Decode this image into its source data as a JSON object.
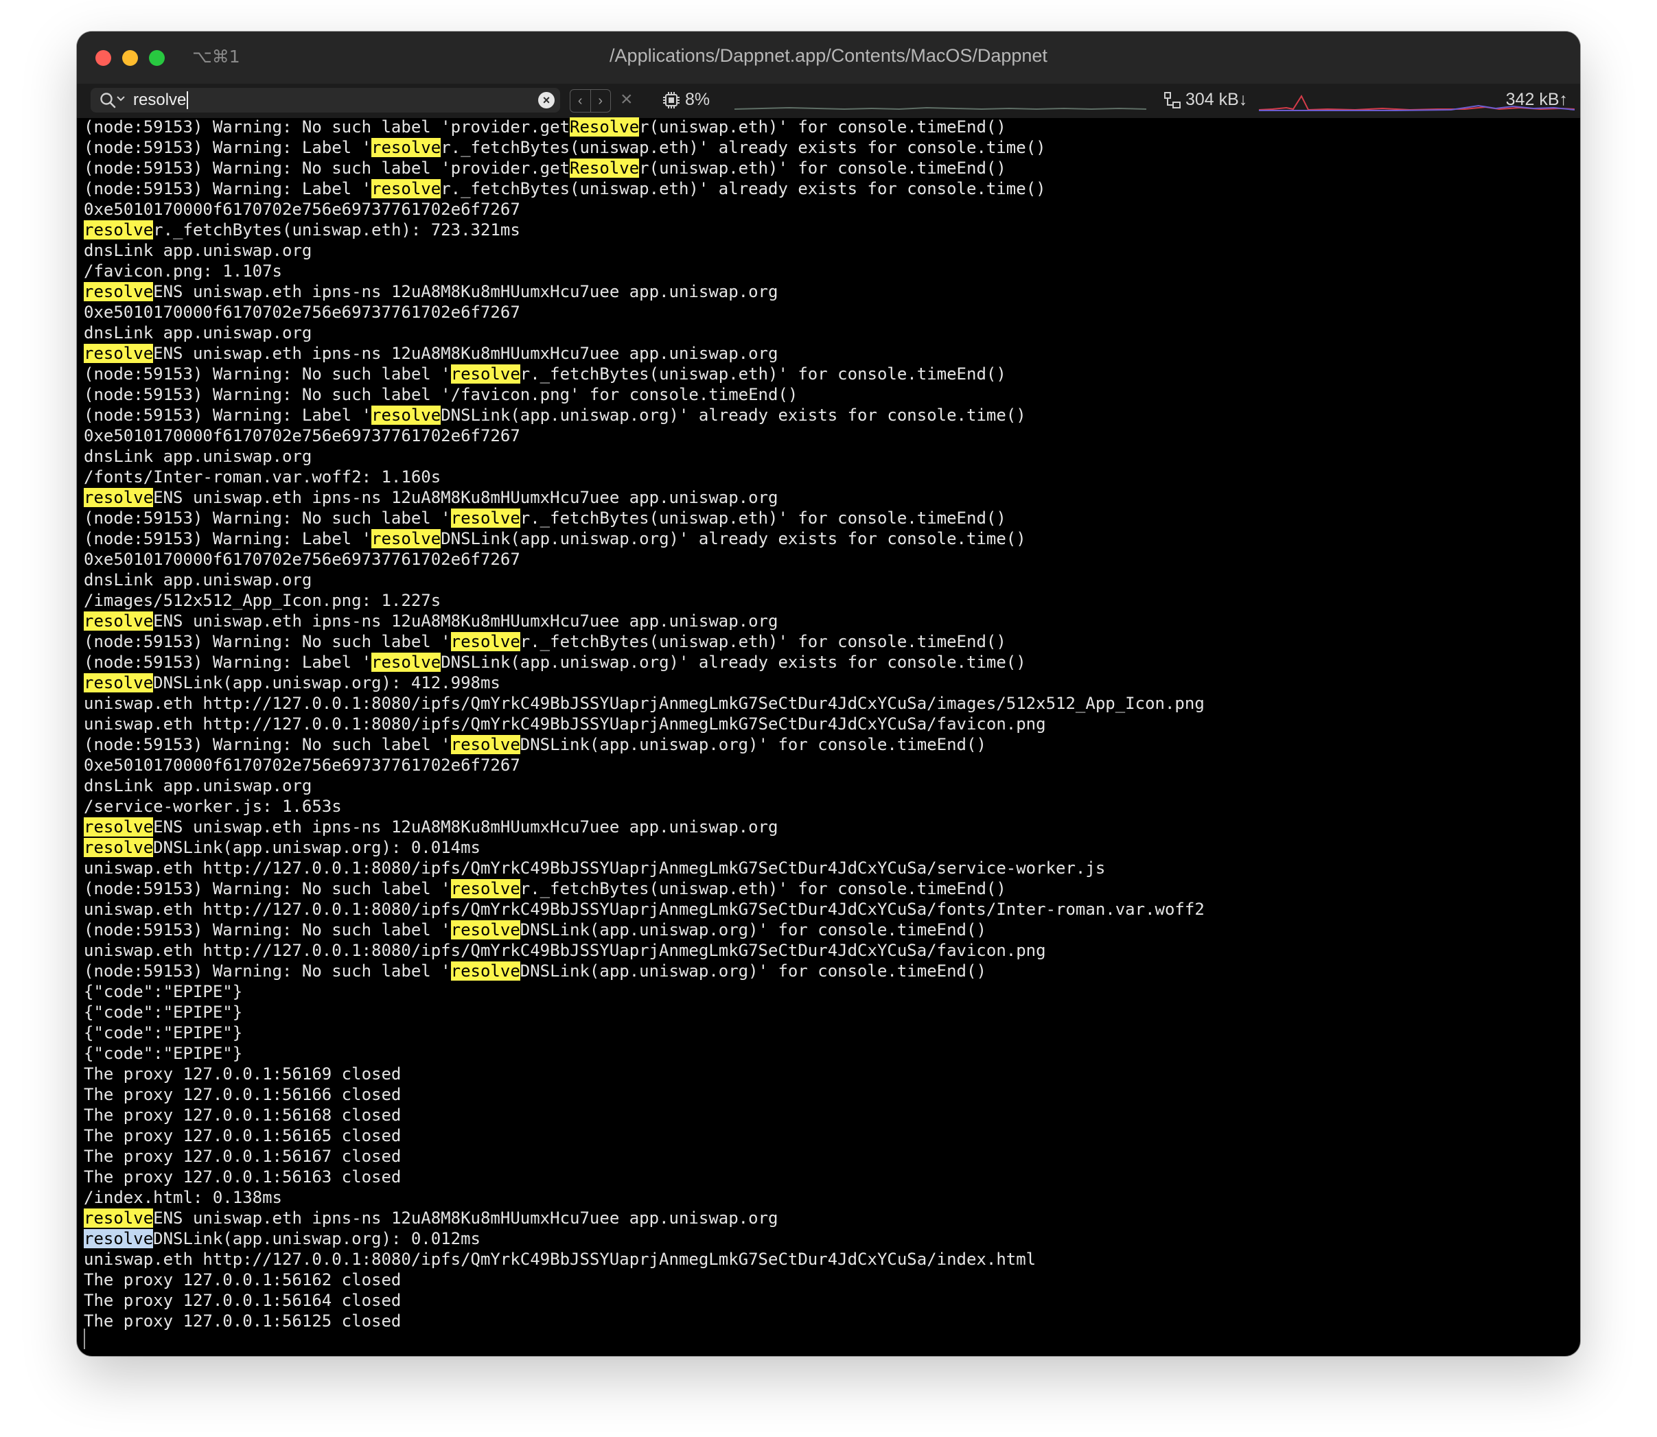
{
  "window": {
    "title": "/Applications/Dappnet.app/Contents/MacOS/Dappnet",
    "shortcut": "⌥⌘1"
  },
  "search": {
    "query": "resolve",
    "prev_icon": "chevron-left-icon",
    "next_icon": "chevron-right-icon"
  },
  "status": {
    "cpu": "8%",
    "net_down": "304 kB↓",
    "net_up": "342 kB↑"
  },
  "colors": {
    "match_highlight": "#fcf54c",
    "active_match_highlight": "#c2d8f2",
    "net_graph_red": "#d43c4a",
    "net_graph_purple": "#6b5ccf"
  },
  "terminal": {
    "lines": [
      {
        "segments": [
          {
            "t": "(node:59153) Warning: No such label 'provider.get"
          },
          {
            "t": "Resolve",
            "hl": true
          },
          {
            "t": "r(uniswap.eth)' for console.timeEnd()"
          }
        ]
      },
      {
        "segments": [
          {
            "t": "(node:59153) Warning: Label '"
          },
          {
            "t": "resolve",
            "hl": true
          },
          {
            "t": "r._fetchBytes(uniswap.eth)' already exists for console.time()"
          }
        ]
      },
      {
        "segments": [
          {
            "t": "(node:59153) Warning: No such label 'provider.get"
          },
          {
            "t": "Resolve",
            "hl": true
          },
          {
            "t": "r(uniswap.eth)' for console.timeEnd()"
          }
        ]
      },
      {
        "segments": [
          {
            "t": "(node:59153) Warning: Label '"
          },
          {
            "t": "resolve",
            "hl": true
          },
          {
            "t": "r._fetchBytes(uniswap.eth)' already exists for console.time()"
          }
        ]
      },
      {
        "segments": [
          {
            "t": "0xe5010170000f6170702e756e69737761702e6f7267"
          }
        ]
      },
      {
        "segments": [
          {
            "t": "resolve",
            "hl": true
          },
          {
            "t": "r._fetchBytes(uniswap.eth): 723.321ms"
          }
        ]
      },
      {
        "segments": [
          {
            "t": "dnsLink app.uniswap.org"
          }
        ]
      },
      {
        "segments": [
          {
            "t": "/favicon.png: 1.107s"
          }
        ]
      },
      {
        "segments": [
          {
            "t": "resolve",
            "hl": true
          },
          {
            "t": "ENS uniswap.eth ipns-ns 12uA8M8Ku8mHUumxHcu7uee app.uniswap.org"
          }
        ]
      },
      {
        "segments": [
          {
            "t": "0xe5010170000f6170702e756e69737761702e6f7267"
          }
        ]
      },
      {
        "segments": [
          {
            "t": "dnsLink app.uniswap.org"
          }
        ]
      },
      {
        "segments": [
          {
            "t": "resolve",
            "hl": true
          },
          {
            "t": "ENS uniswap.eth ipns-ns 12uA8M8Ku8mHUumxHcu7uee app.uniswap.org"
          }
        ]
      },
      {
        "segments": [
          {
            "t": "(node:59153) Warning: No such label '"
          },
          {
            "t": "resolve",
            "hl": true
          },
          {
            "t": "r._fetchBytes(uniswap.eth)' for console.timeEnd()"
          }
        ]
      },
      {
        "segments": [
          {
            "t": "(node:59153) Warning: No such label '/favicon.png' for console.timeEnd()"
          }
        ]
      },
      {
        "segments": [
          {
            "t": "(node:59153) Warning: Label '"
          },
          {
            "t": "resolve",
            "hl": true
          },
          {
            "t": "DNSLink(app.uniswap.org)' already exists for console.time()"
          }
        ]
      },
      {
        "segments": [
          {
            "t": "0xe5010170000f6170702e756e69737761702e6f7267"
          }
        ]
      },
      {
        "segments": [
          {
            "t": "dnsLink app.uniswap.org"
          }
        ]
      },
      {
        "segments": [
          {
            "t": "/fonts/Inter-roman.var.woff2: 1.160s"
          }
        ]
      },
      {
        "segments": [
          {
            "t": "resolve",
            "hl": true
          },
          {
            "t": "ENS uniswap.eth ipns-ns 12uA8M8Ku8mHUumxHcu7uee app.uniswap.org"
          }
        ]
      },
      {
        "segments": [
          {
            "t": "(node:59153) Warning: No such label '"
          },
          {
            "t": "resolve",
            "hl": true
          },
          {
            "t": "r._fetchBytes(uniswap.eth)' for console.timeEnd()"
          }
        ]
      },
      {
        "segments": [
          {
            "t": "(node:59153) Warning: Label '"
          },
          {
            "t": "resolve",
            "hl": true
          },
          {
            "t": "DNSLink(app.uniswap.org)' already exists for console.time()"
          }
        ]
      },
      {
        "segments": [
          {
            "t": "0xe5010170000f6170702e756e69737761702e6f7267"
          }
        ]
      },
      {
        "segments": [
          {
            "t": "dnsLink app.uniswap.org"
          }
        ]
      },
      {
        "segments": [
          {
            "t": "/images/512x512_App_Icon.png: 1.227s"
          }
        ]
      },
      {
        "segments": [
          {
            "t": "resolve",
            "hl": true
          },
          {
            "t": "ENS uniswap.eth ipns-ns 12uA8M8Ku8mHUumxHcu7uee app.uniswap.org"
          }
        ]
      },
      {
        "segments": [
          {
            "t": "(node:59153) Warning: No such label '"
          },
          {
            "t": "resolve",
            "hl": true
          },
          {
            "t": "r._fetchBytes(uniswap.eth)' for console.timeEnd()"
          }
        ]
      },
      {
        "segments": [
          {
            "t": "(node:59153) Warning: Label '"
          },
          {
            "t": "resolve",
            "hl": true
          },
          {
            "t": "DNSLink(app.uniswap.org)' already exists for console.time()"
          }
        ]
      },
      {
        "segments": [
          {
            "t": "resolve",
            "hl": true
          },
          {
            "t": "DNSLink(app.uniswap.org): 412.998ms"
          }
        ]
      },
      {
        "segments": [
          {
            "t": "uniswap.eth http://127.0.0.1:8080/ipfs/QmYrkC49BbJSSYUaprjAnmegLmkG7SeCtDur4JdCxYCuSa/images/512x512_App_Icon.png"
          }
        ]
      },
      {
        "segments": [
          {
            "t": "uniswap.eth http://127.0.0.1:8080/ipfs/QmYrkC49BbJSSYUaprjAnmegLmkG7SeCtDur4JdCxYCuSa/favicon.png"
          }
        ]
      },
      {
        "segments": [
          {
            "t": "(node:59153) Warning: No such label '"
          },
          {
            "t": "resolve",
            "hl": true
          },
          {
            "t": "DNSLink(app.uniswap.org)' for console.timeEnd()"
          }
        ]
      },
      {
        "segments": [
          {
            "t": "0xe5010170000f6170702e756e69737761702e6f7267"
          }
        ]
      },
      {
        "segments": [
          {
            "t": "dnsLink app.uniswap.org"
          }
        ]
      },
      {
        "segments": [
          {
            "t": "/service-worker.js: 1.653s"
          }
        ]
      },
      {
        "segments": [
          {
            "t": "resolve",
            "hl": true
          },
          {
            "t": "ENS uniswap.eth ipns-ns 12uA8M8Ku8mHUumxHcu7uee app.uniswap.org"
          }
        ]
      },
      {
        "segments": [
          {
            "t": "resolve",
            "hl": true
          },
          {
            "t": "DNSLink(app.uniswap.org): 0.014ms"
          }
        ]
      },
      {
        "segments": [
          {
            "t": "uniswap.eth http://127.0.0.1:8080/ipfs/QmYrkC49BbJSSYUaprjAnmegLmkG7SeCtDur4JdCxYCuSa/service-worker.js"
          }
        ]
      },
      {
        "segments": [
          {
            "t": "(node:59153) Warning: No such label '"
          },
          {
            "t": "resolve",
            "hl": true
          },
          {
            "t": "r._fetchBytes(uniswap.eth)' for console.timeEnd()"
          }
        ]
      },
      {
        "segments": [
          {
            "t": "uniswap.eth http://127.0.0.1:8080/ipfs/QmYrkC49BbJSSYUaprjAnmegLmkG7SeCtDur4JdCxYCuSa/fonts/Inter-roman.var.woff2"
          }
        ]
      },
      {
        "segments": [
          {
            "t": "(node:59153) Warning: No such label '"
          },
          {
            "t": "resolve",
            "hl": true
          },
          {
            "t": "DNSLink(app.uniswap.org)' for console.timeEnd()"
          }
        ]
      },
      {
        "segments": [
          {
            "t": "uniswap.eth http://127.0.0.1:8080/ipfs/QmYrkC49BbJSSYUaprjAnmegLmkG7SeCtDur4JdCxYCuSa/favicon.png"
          }
        ]
      },
      {
        "segments": [
          {
            "t": "(node:59153) Warning: No such label '"
          },
          {
            "t": "resolve",
            "hl": true
          },
          {
            "t": "DNSLink(app.uniswap.org)' for console.timeEnd()"
          }
        ]
      },
      {
        "segments": [
          {
            "t": "{\"code\":\"EPIPE\"}"
          }
        ]
      },
      {
        "segments": [
          {
            "t": "{\"code\":\"EPIPE\"}"
          }
        ]
      },
      {
        "segments": [
          {
            "t": "{\"code\":\"EPIPE\"}"
          }
        ]
      },
      {
        "segments": [
          {
            "t": "{\"code\":\"EPIPE\"}"
          }
        ]
      },
      {
        "segments": [
          {
            "t": "The proxy 127.0.0.1:56169 closed"
          }
        ]
      },
      {
        "segments": [
          {
            "t": "The proxy 127.0.0.1:56166 closed"
          }
        ]
      },
      {
        "segments": [
          {
            "t": "The proxy 127.0.0.1:56168 closed"
          }
        ]
      },
      {
        "segments": [
          {
            "t": "The proxy 127.0.0.1:56165 closed"
          }
        ]
      },
      {
        "segments": [
          {
            "t": "The proxy 127.0.0.1:56167 closed"
          }
        ]
      },
      {
        "segments": [
          {
            "t": "The proxy 127.0.0.1:56163 closed"
          }
        ]
      },
      {
        "segments": [
          {
            "t": "/index.html: 0.138ms"
          }
        ]
      },
      {
        "segments": [
          {
            "t": "resolve",
            "hl": true
          },
          {
            "t": "ENS uniswap.eth ipns-ns 12uA8M8Ku8mHUumxHcu7uee app.uniswap.org"
          }
        ]
      },
      {
        "segments": [
          {
            "t": "resolve",
            "hl": true,
            "active": true
          },
          {
            "t": "DNSLink(app.uniswap.org): 0.012ms"
          }
        ]
      },
      {
        "segments": [
          {
            "t": "uniswap.eth http://127.0.0.1:8080/ipfs/QmYrkC49BbJSSYUaprjAnmegLmkG7SeCtDur4JdCxYCuSa/index.html"
          }
        ]
      },
      {
        "segments": [
          {
            "t": "The proxy 127.0.0.1:56162 closed"
          }
        ]
      },
      {
        "segments": [
          {
            "t": "The proxy 127.0.0.1:56164 closed"
          }
        ]
      },
      {
        "segments": [
          {
            "t": "The proxy 127.0.0.1:56125 closed"
          }
        ]
      }
    ]
  }
}
